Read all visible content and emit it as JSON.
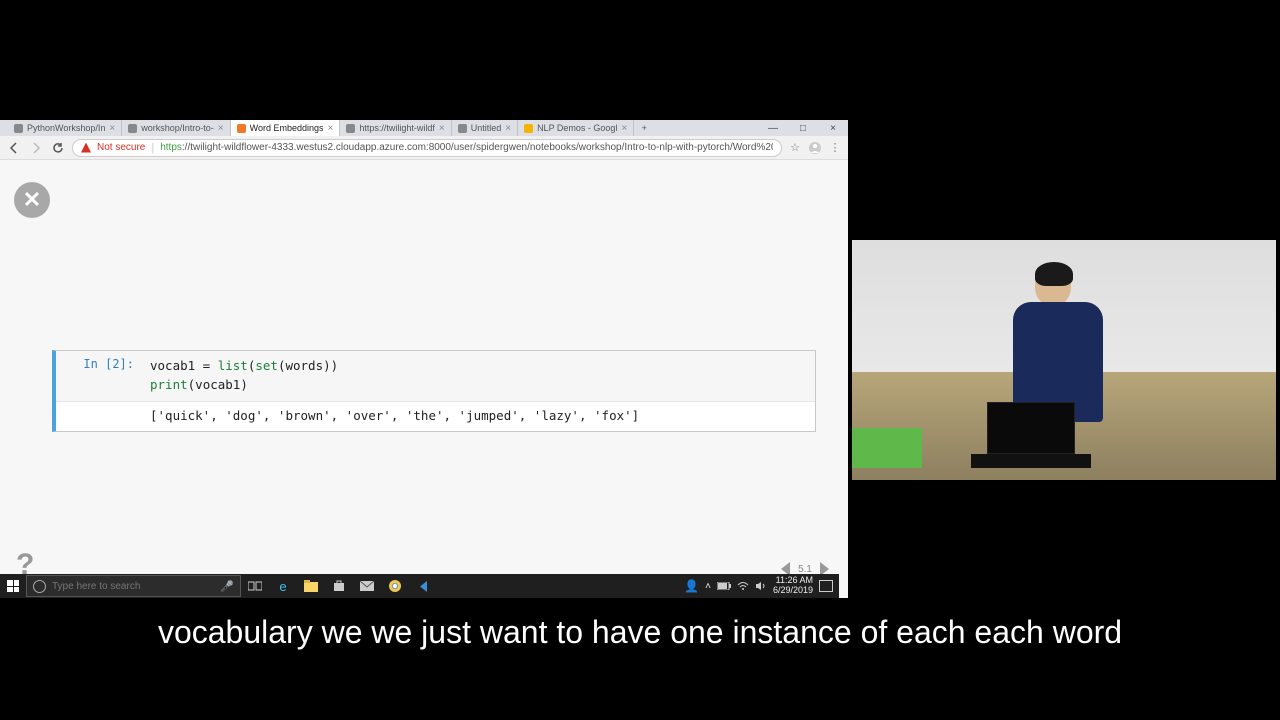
{
  "browser": {
    "tabs": [
      {
        "label": "PythonWorkshop/In",
        "active": false
      },
      {
        "label": "workshop/Intro-to-",
        "active": false
      },
      {
        "label": "Word Embeddings",
        "active": true
      },
      {
        "label": "https://twilight-wildf",
        "active": false
      },
      {
        "label": "Untitled",
        "active": false
      },
      {
        "label": "NLP Demos - Googl",
        "active": false
      }
    ],
    "url_prefix_https": "https",
    "url_rest": "://twilight-wildflower-4333.westus2.cloudapp.azure.com:8000/user/spidergwen/notebooks/workshop/Intro-to-nlp-with-pytorch/Word%20Embed…",
    "not_secure": "Not secure"
  },
  "notebook": {
    "prompt": "In [2]:",
    "code_line1_pre": "vocab1 = ",
    "code_line1_func1": "list",
    "code_line1_paren1": "(",
    "code_line1_func2": "set",
    "code_line1_paren2": "(words))",
    "code_line2_func": "print",
    "code_line2_rest": "(vocab1)",
    "output": "['quick', 'dog', 'brown', 'over', 'the', 'jumped', 'lazy', 'fox']",
    "slide_page": "5.1"
  },
  "taskbar": {
    "search_placeholder": "Type here to search",
    "time": "11:26 AM",
    "date": "6/29/2019"
  },
  "caption": "vocabulary we we just want to have one instance of each each word"
}
